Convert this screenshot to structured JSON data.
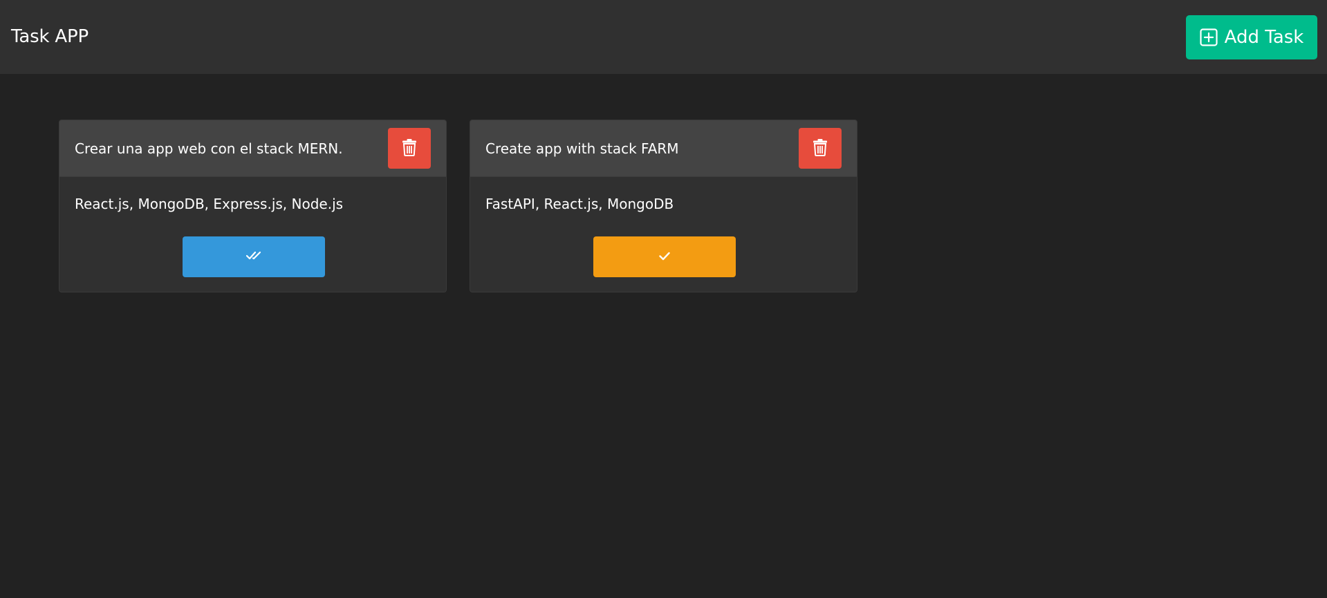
{
  "navbar": {
    "title": "Task APP",
    "add_button": {
      "label": "Add Task",
      "icon": "plus-square-icon"
    }
  },
  "tasks": [
    {
      "title": "Crear una app web con el stack MERN.",
      "description": "React.js, MongoDB, Express.js, Node.js",
      "completed": true,
      "status_icon": "check-double-icon",
      "status_color": "#3498db"
    },
    {
      "title": "Create app with stack FARM",
      "description": "FastAPI, React.js, MongoDB",
      "completed": false,
      "status_icon": "check-icon",
      "status_color": "#f39c12"
    }
  ],
  "colors": {
    "background": "#222222",
    "navbar": "#303030",
    "accent": "#00bc8c",
    "danger": "#e74c3c",
    "card": "#303030",
    "card_header": "#444444"
  }
}
